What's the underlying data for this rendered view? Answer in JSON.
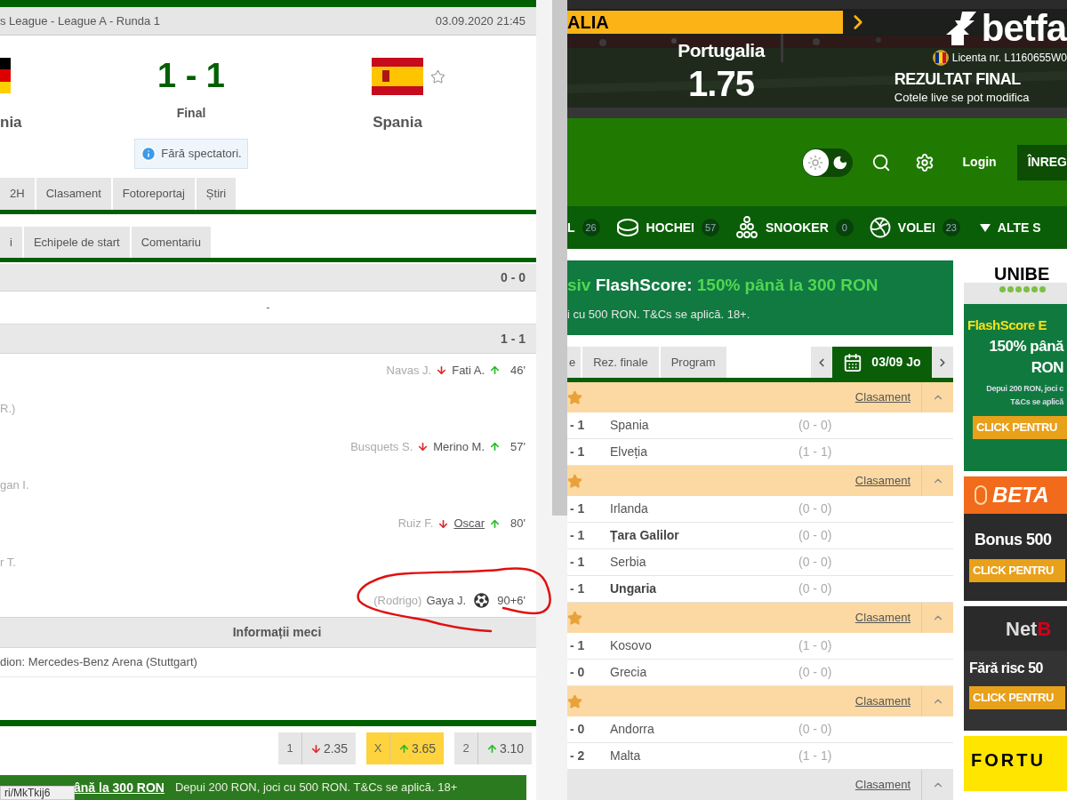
{
  "match_window": {
    "breadcrumb": "s League - League A - Runda 1",
    "datetime": "03.09.2020 21:45",
    "home": {
      "name": "nia"
    },
    "away": {
      "name": "Spania",
      "favorite": false
    },
    "score": "1 - 1",
    "status": "Final",
    "info": "Fără spectatori.",
    "tabs": [
      {
        "label": "2H",
        "selected": false
      },
      {
        "label": "Clasament",
        "selected": false
      },
      {
        "label": "Fotoreportaj",
        "selected": false
      },
      {
        "label": "Știri",
        "selected": false
      }
    ],
    "subtabs": [
      {
        "label": "i",
        "selected": false
      },
      {
        "label": "Echipele de start",
        "selected": false
      },
      {
        "label": "Comentariu",
        "selected": false
      }
    ],
    "periods": [
      {
        "score": "0 - 0",
        "events": [
          {
            "kind": "none",
            "text": "-"
          }
        ]
      },
      {
        "score": "1 - 1",
        "events": [
          {
            "kind": "substitution",
            "out": "Navas J.",
            "in": "Fati A.",
            "minute": "46'",
            "linked": false
          },
          {
            "kind": "home_text",
            "text": "R.)"
          },
          {
            "kind": "substitution",
            "out": "Busquets S.",
            "in": "Merino M.",
            "minute": "57'",
            "linked": false
          },
          {
            "kind": "home_text",
            "text": "gan I."
          },
          {
            "kind": "substitution",
            "out": "Ruiz F.",
            "in": "Oscar",
            "minute": "80'",
            "linked": true
          },
          {
            "kind": "home_text",
            "text": "r T."
          },
          {
            "kind": "goal",
            "assist": "(Rodrigo)",
            "player": "Gaya J.",
            "minute": "90+6'"
          }
        ]
      }
    ],
    "info_title": "Informații meci",
    "venue": "dion: Mercedes-Benz Arena (Stuttgart)",
    "odds": [
      {
        "label": "1",
        "value": "2.35",
        "rising": false,
        "selected": false
      },
      {
        "label": "X",
        "value": "3.65",
        "rising": true,
        "selected": true
      },
      {
        "label": "2",
        "value": "3.10",
        "rising": true,
        "selected": false
      }
    ],
    "promo": {
      "link": "ână la 300 RON",
      "text": "Depui 200 RON, joci cu 500 RON. T&Cs se aplică. 18+"
    },
    "status_url": "ri/MkTkij6"
  },
  "site": {
    "banner": {
      "tag": "ALIA",
      "team": "Portugalia",
      "odd": "1.75",
      "logo": "betfa",
      "license": "Licenta nr. L1160655W0",
      "market": "REZULTAT FINAL",
      "note": "Cotele live se pot modifica"
    },
    "header": {
      "dark_mode": false,
      "login": "Login",
      "register": "ÎNREG"
    },
    "sports": [
      {
        "label": "L",
        "count": "26",
        "kind": "plain"
      },
      {
        "label": "HOCHEI",
        "count": "57",
        "kind": "puck"
      },
      {
        "label": "SNOOKER",
        "count": "0",
        "kind": "balls"
      },
      {
        "label": "VOLEI",
        "count": "23",
        "kind": "volleyball"
      }
    ],
    "more": "ALTE S",
    "promo": {
      "lead": "siv",
      "brand": "FlashScore:",
      "offer": "150% până la 300 RON",
      "text": "i cu 500 RON. T&Cs se aplică. 18+."
    },
    "tabs": [
      {
        "label": "e",
        "selected": false
      },
      {
        "label": "Rez. finale",
        "selected": false
      },
      {
        "label": "Program",
        "selected": false
      }
    ],
    "date": "03/09 Jo",
    "leagues": [
      {
        "standings": "Clasament",
        "highlighted": true,
        "starred": true,
        "matches": [
          {
            "score": "- 1",
            "team": "Spania",
            "half": "(0 - 0)",
            "winner": false
          },
          {
            "score": "- 1",
            "team": "Elveția",
            "half": "(1 - 1)",
            "winner": false
          }
        ]
      },
      {
        "standings": "Clasament",
        "highlighted": true,
        "starred": true,
        "matches": [
          {
            "score": "- 1",
            "team": "Irlanda",
            "half": "(0 - 0)",
            "winner": false
          },
          {
            "score": "- 1",
            "team": "Țara Galilor",
            "half": "(0 - 0)",
            "winner": true
          },
          {
            "score": "- 1",
            "team": "Serbia",
            "half": "(0 - 0)",
            "winner": false
          },
          {
            "score": "- 1",
            "team": "Ungaria",
            "half": "(0 - 0)",
            "winner": true
          }
        ]
      },
      {
        "standings": "Clasament",
        "highlighted": true,
        "starred": true,
        "matches": [
          {
            "score": "- 1",
            "team": "Kosovo",
            "half": "(1 - 0)",
            "winner": false
          },
          {
            "score": "- 0",
            "team": "Grecia",
            "half": "(0 - 0)",
            "winner": false
          }
        ]
      },
      {
        "standings": "Clasament",
        "highlighted": true,
        "starred": true,
        "matches": [
          {
            "score": "- 0",
            "team": "Andorra",
            "half": "(0 - 0)",
            "winner": false
          },
          {
            "score": "- 2",
            "team": "Malta",
            "half": "(1 - 1)",
            "winner": false
          }
        ]
      },
      {
        "standings": "Clasament",
        "highlighted": false,
        "starred": false
      }
    ],
    "ads": [
      {
        "kind": "unibet",
        "logo": "UNIBE",
        "title": "FlashScore E",
        "headline": [
          "150% până",
          "RON"
        ],
        "small": [
          "Depui 200 RON, joci c",
          "T&Cs se aplică"
        ],
        "button": "CLICK PENTRU"
      },
      {
        "kind": "betano",
        "logo": "BETA",
        "title": "Bonus 500",
        "button": "CLICK PENTRU"
      },
      {
        "kind": "netbet",
        "logo": "Net",
        "logo_accent": "B",
        "title": "Fără risc 50",
        "button": "CLICK PENTRU"
      },
      {
        "kind": "fortuna",
        "logo": "FORTU"
      }
    ]
  }
}
